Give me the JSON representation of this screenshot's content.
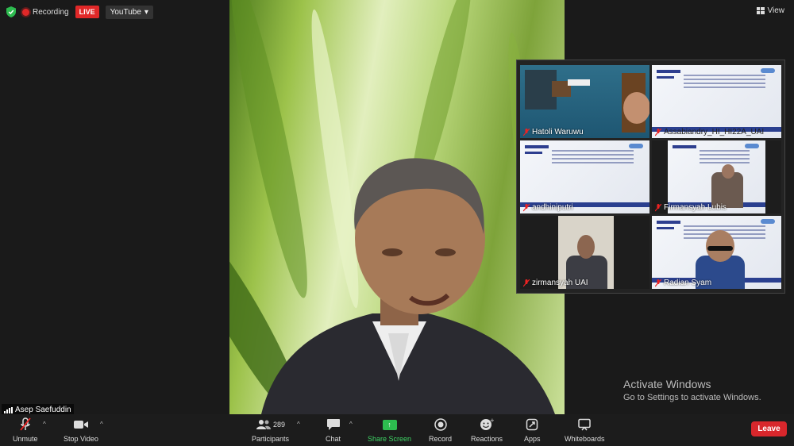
{
  "top": {
    "recording_label": "Recording",
    "live_label": "LIVE",
    "stream_target": "YouTube",
    "view_label": "View"
  },
  "main_speaker": {
    "name": "Asep Saefuddin"
  },
  "gallery": {
    "tiles": [
      {
        "name": "Hatoli Waruwu",
        "type": "camera"
      },
      {
        "name": "Assabiandry_HI_HI22A_UAI",
        "type": "slide"
      },
      {
        "name": "andhiniputri",
        "type": "slide"
      },
      {
        "name": "Firmansyah Lubis",
        "type": "slide-camera"
      },
      {
        "name": "zirmansyah UAI",
        "type": "camera"
      },
      {
        "name": "Radian Syam",
        "type": "slide-camera"
      }
    ]
  },
  "watermark": {
    "line1": "Activate Windows",
    "line2": "Go to Settings to activate Windows."
  },
  "toolbar": {
    "unmute": "Unmute",
    "stop_video": "Stop Video",
    "participants": "Participants",
    "participants_count": "289",
    "chat": "Chat",
    "share_screen": "Share Screen",
    "record": "Record",
    "reactions": "Reactions",
    "apps": "Apps",
    "whiteboards": "Whiteboards",
    "leave": "Leave"
  },
  "colors": {
    "leave": "#d8272c",
    "live": "#e02828",
    "share": "#2dbb4f"
  }
}
